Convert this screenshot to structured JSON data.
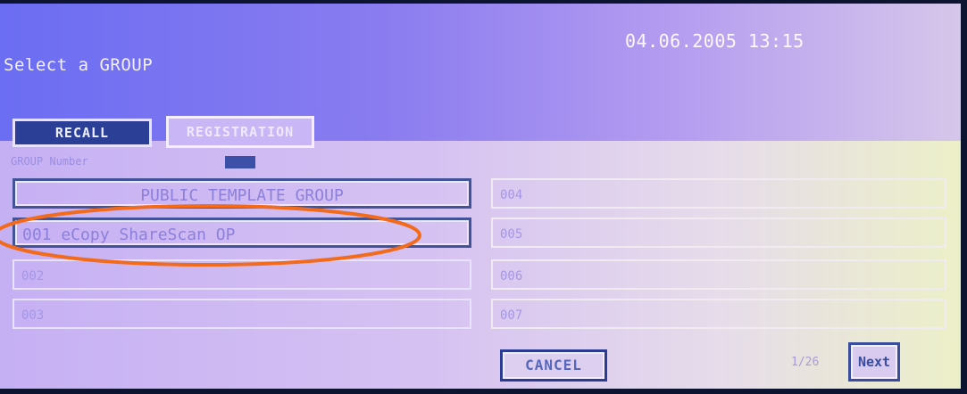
{
  "header": {
    "title": "Select a GROUP",
    "datetime": "04.06.2005 13:15"
  },
  "tabs": [
    {
      "label": "RECALL",
      "active": true
    },
    {
      "label": "REGISTRATION",
      "active": false
    }
  ],
  "group_number_label": "GROUP Number",
  "groups_left": [
    "PUBLIC TEMPLATE GROUP",
    "001 eCopy ShareScan OP",
    "002",
    "003"
  ],
  "groups_right": [
    "004",
    "005",
    "006",
    "007"
  ],
  "footer": {
    "cancel_label": "CANCEL",
    "page_indicator": "1/26",
    "next_label": "Next"
  },
  "colors": {
    "highlight_oval": "#f26a1b",
    "active_tab": "#2c3f96"
  }
}
